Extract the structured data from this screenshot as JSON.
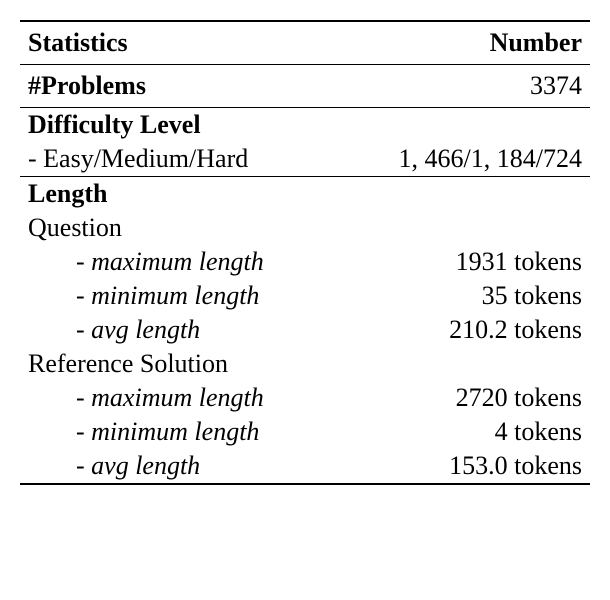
{
  "header": {
    "left": "Statistics",
    "right": "Number"
  },
  "problems": {
    "label": "#Problems",
    "value": "3374"
  },
  "difficulty": {
    "heading": "Difficulty Level",
    "row_label": "- Easy/Medium/Hard",
    "row_value": "1, 466/1, 184/724"
  },
  "length": {
    "heading": "Length",
    "question": {
      "label": "Question",
      "rows": [
        {
          "label": "- maximum length",
          "value": "1931 tokens"
        },
        {
          "label": "- minimum length",
          "value": "35 tokens"
        },
        {
          "label": "- avg length",
          "value": "210.2 tokens"
        }
      ]
    },
    "reference": {
      "label": "Reference Solution",
      "rows": [
        {
          "label": "- maximum length",
          "value": "2720 tokens"
        },
        {
          "label": "- minimum length",
          "value": "4 tokens"
        },
        {
          "label": "- avg length",
          "value": "153.0 tokens"
        }
      ]
    }
  }
}
